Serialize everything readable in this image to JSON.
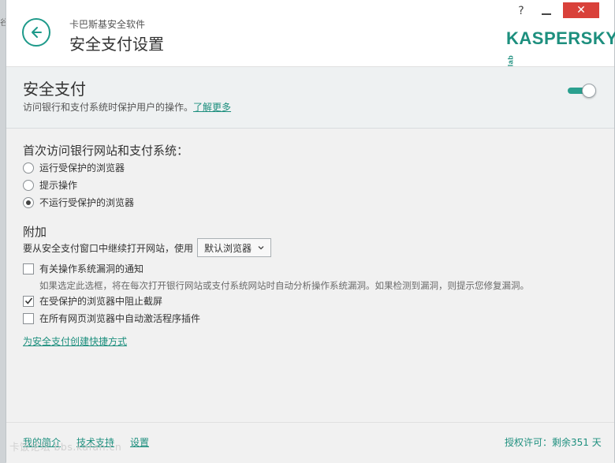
{
  "header": {
    "subtitle": "卡巴斯基安全软件",
    "title": "安全支付设置",
    "help_label": "?",
    "close_label": "✕",
    "logo_text": "KASPERSKY",
    "logo_lab": "lab",
    "brand_color": "#1d8f7e"
  },
  "band": {
    "title": "安全支付",
    "description": "访问银行和支付系统时保护用户的操作。",
    "learn_more": "了解更多",
    "toggle_on": true
  },
  "first_visit": {
    "heading": "首次访问银行网站和支付系统：",
    "options": [
      {
        "label": "运行受保护的浏览器",
        "checked": false
      },
      {
        "label": "提示操作",
        "checked": false
      },
      {
        "label": "不运行受保护的浏览器",
        "checked": true
      }
    ]
  },
  "extra": {
    "heading": "附加",
    "browser_prefix": "要从安全支付窗口中继续打开网站，使用",
    "browser_select": "默认浏览器",
    "checks": [
      {
        "label": "有关操作系统漏洞的通知",
        "checked": false
      },
      {
        "label": "在受保护的浏览器中阻止截屏",
        "checked": true
      },
      {
        "label": "在所有网页浏览器中自动激活程序插件",
        "checked": false
      }
    ],
    "hint": "如果选定此选框，将在每次打开银行网站或支付系统网站时自动分析操作系统漏洞。如果检测到漏洞，则提示您修复漏洞。",
    "shortcut_link": "为安全支付创建快捷方式"
  },
  "footer": {
    "links": [
      "我的简介",
      "技术支持",
      "设置"
    ],
    "license": "授权许可：剩余351 天"
  },
  "watermark": "卡饭论坛 bbs.kafan.cn",
  "left_fragment": "谷"
}
